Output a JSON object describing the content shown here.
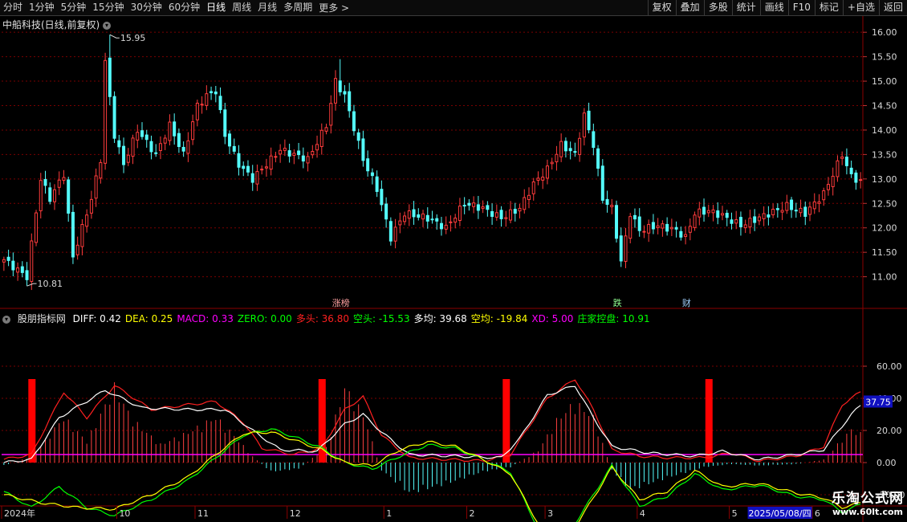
{
  "toolbar": {
    "timeframes": [
      "分时",
      "1分钟",
      "5分钟",
      "15分钟",
      "30分钟",
      "60分钟",
      "日线",
      "周线",
      "月线",
      "多周期"
    ],
    "active": "日线",
    "more": "更多 >",
    "tools": [
      "复权",
      "叠加",
      "多股",
      "统计",
      "画线",
      "F10",
      "标记",
      "+自选",
      "返回"
    ]
  },
  "price_panel": {
    "title": "中船科技(日线,前复权)"
  },
  "indicator_header": {
    "name": "股朋指标网",
    "items": [
      {
        "label": "DIFF",
        "value": "0.42",
        "color": "#ffffff"
      },
      {
        "label": "DEA",
        "value": "0.25",
        "color": "#ffff00"
      },
      {
        "label": "MACD",
        "value": "0.33",
        "color": "#ff00ff"
      },
      {
        "label": "ZERO",
        "value": "0.00",
        "color": "#00ff00"
      },
      {
        "label": "多头",
        "value": "36.80",
        "color": "#ff2020"
      },
      {
        "label": "空头",
        "value": "-15.53",
        "color": "#00ff00"
      },
      {
        "label": "多均",
        "value": "39.68",
        "color": "#ffffff"
      },
      {
        "label": "空均",
        "value": "-19.84",
        "color": "#ffff00"
      },
      {
        "label": "XD",
        "value": "5.00",
        "color": "#ff00ff"
      },
      {
        "label": "庄家控盘",
        "value": "10.91",
        "color": "#00ff00"
      }
    ]
  },
  "chart_data": [
    {
      "type": "candlestick",
      "title": "中船科技(日线,前复权)",
      "ylim": [
        10.55,
        16.2
      ],
      "yticks": [
        "16.00",
        "15.50",
        "15.00",
        "14.50",
        "14.00",
        "13.50",
        "13.00",
        "12.50",
        "12.00",
        "11.50",
        "11.00"
      ],
      "high_label": "15.95",
      "low_label": "10.81",
      "x_labels": [
        "2024年",
        "10",
        "11",
        "12",
        "1",
        "2",
        "3",
        "4",
        "5",
        "6"
      ],
      "cursor_date": "2025/05/08/四",
      "events": [
        "涨榜",
        "跌",
        "财"
      ],
      "anchors": [
        [
          0,
          11.35
        ],
        [
          5,
          11.0
        ],
        [
          8,
          13.0
        ],
        [
          10,
          12.6
        ],
        [
          13,
          13.1
        ],
        [
          15,
          11.4
        ],
        [
          19,
          12.6
        ],
        [
          21,
          13.4
        ],
        [
          22,
          15.4
        ],
        [
          24,
          13.9
        ],
        [
          26,
          13.3
        ],
        [
          29,
          14.0
        ],
        [
          33,
          13.5
        ],
        [
          36,
          14.1
        ],
        [
          39,
          13.5
        ],
        [
          42,
          14.5
        ],
        [
          44,
          14.7
        ],
        [
          46,
          14.8
        ],
        [
          48,
          13.9
        ],
        [
          51,
          13.3
        ],
        [
          54,
          13.0
        ],
        [
          57,
          13.3
        ],
        [
          60,
          13.6
        ],
        [
          63,
          13.5
        ],
        [
          66,
          13.4
        ],
        [
          70,
          14.1
        ],
        [
          72,
          15.0
        ],
        [
          74,
          14.7
        ],
        [
          78,
          13.4
        ],
        [
          81,
          12.8
        ],
        [
          84,
          11.8
        ],
        [
          87,
          12.3
        ],
        [
          92,
          12.2
        ],
        [
          96,
          12.0
        ],
        [
          100,
          12.5
        ],
        [
          104,
          12.4
        ],
        [
          108,
          12.2
        ],
        [
          112,
          12.4
        ],
        [
          115,
          12.9
        ],
        [
          118,
          13.2
        ],
        [
          121,
          13.7
        ],
        [
          124,
          13.5
        ],
        [
          126,
          14.3
        ],
        [
          128,
          13.7
        ],
        [
          130,
          12.6
        ],
        [
          132,
          12.4
        ],
        [
          134,
          11.3
        ],
        [
          136,
          12.3
        ],
        [
          138,
          11.95
        ],
        [
          142,
          12.05
        ],
        [
          146,
          11.95
        ],
        [
          148,
          11.8
        ],
        [
          150,
          12.3
        ],
        [
          153,
          12.35
        ],
        [
          156,
          12.25
        ],
        [
          160,
          12.05
        ],
        [
          165,
          12.25
        ],
        [
          170,
          12.45
        ],
        [
          174,
          12.3
        ],
        [
          178,
          12.7
        ],
        [
          180,
          13.1
        ],
        [
          182,
          13.5
        ],
        [
          184,
          13.05
        ],
        [
          186,
          12.95
        ]
      ],
      "spikes": [
        {
          "i": 23,
          "high": 15.95
        },
        {
          "i": 5,
          "low": 10.81
        },
        {
          "i": 73,
          "high": 15.45
        },
        {
          "i": 126,
          "high": 14.45
        },
        {
          "i": 134,
          "low": 11.2
        }
      ]
    },
    {
      "type": "indicator",
      "ylim": [
        -27,
        88
      ],
      "yticks": [
        "60.00",
        "40.00",
        "20.00",
        "0.00",
        "-20.00"
      ],
      "current_value": "37.75",
      "signal_indices": [
        6,
        69,
        109,
        153
      ],
      "xd_level": 5,
      "series": [
        {
          "name": "多头",
          "color": "#ff2020",
          "anchors": [
            [
              0,
              2
            ],
            [
              6,
              5
            ],
            [
              13,
              44
            ],
            [
              18,
              28
            ],
            [
              24,
              48
            ],
            [
              32,
              33
            ],
            [
              40,
              36
            ],
            [
              46,
              38
            ],
            [
              52,
              25
            ],
            [
              56,
              9
            ],
            [
              63,
              5
            ],
            [
              69,
              9
            ],
            [
              74,
              33
            ],
            [
              78,
              41
            ],
            [
              82,
              17
            ],
            [
              88,
              3
            ],
            [
              96,
              2
            ],
            [
              104,
              1
            ],
            [
              110,
              5
            ],
            [
              118,
              40
            ],
            [
              124,
              52
            ],
            [
              128,
              33
            ],
            [
              132,
              8
            ],
            [
              138,
              4
            ],
            [
              144,
              3
            ],
            [
              152,
              3
            ],
            [
              158,
              6
            ],
            [
              164,
              1
            ],
            [
              172,
              4
            ],
            [
              178,
              10
            ],
            [
              182,
              36
            ],
            [
              186,
              44
            ],
            [
              190,
              38
            ]
          ]
        },
        {
          "name": "多均",
          "color": "#ffffff",
          "anchors": [
            [
              0,
              0
            ],
            [
              6,
              2
            ],
            [
              12,
              28
            ],
            [
              22,
              45
            ],
            [
              30,
              34
            ],
            [
              40,
              33
            ],
            [
              48,
              33
            ],
            [
              54,
              20
            ],
            [
              60,
              8
            ],
            [
              68,
              7
            ],
            [
              74,
              24
            ],
            [
              78,
              30
            ],
            [
              82,
              19
            ],
            [
              88,
              5
            ],
            [
              98,
              4
            ],
            [
              108,
              3
            ],
            [
              112,
              15
            ],
            [
              118,
              42
            ],
            [
              124,
              48
            ],
            [
              128,
              28
            ],
            [
              132,
              10
            ],
            [
              140,
              6
            ],
            [
              150,
              4
            ],
            [
              156,
              7
            ],
            [
              164,
              2
            ],
            [
              172,
              5
            ],
            [
              178,
              8
            ],
            [
              184,
              30
            ],
            [
              188,
              41
            ],
            [
              190,
              39
            ]
          ]
        },
        {
          "name": "空头",
          "color": "#00ff00",
          "anchors": [
            [
              0,
              -18
            ],
            [
              6,
              -28
            ],
            [
              12,
              -15
            ],
            [
              18,
              -28
            ],
            [
              24,
              -33
            ],
            [
              32,
              -23
            ],
            [
              40,
              -11
            ],
            [
              46,
              3
            ],
            [
              52,
              17
            ],
            [
              58,
              21
            ],
            [
              64,
              15
            ],
            [
              69,
              9
            ],
            [
              74,
              0
            ],
            [
              80,
              -4
            ],
            [
              86,
              4
            ],
            [
              92,
              11
            ],
            [
              98,
              9
            ],
            [
              104,
              2
            ],
            [
              110,
              -6
            ],
            [
              116,
              -41
            ],
            [
              120,
              -50
            ],
            [
              124,
              -38
            ],
            [
              128,
              -20
            ],
            [
              132,
              -2
            ],
            [
              138,
              -27
            ],
            [
              144,
              -21
            ],
            [
              150,
              -7
            ],
            [
              156,
              -17
            ],
            [
              164,
              -14
            ],
            [
              172,
              -21
            ],
            [
              178,
              -23
            ],
            [
              182,
              -31
            ],
            [
              186,
              -26
            ],
            [
              190,
              -16
            ]
          ]
        },
        {
          "name": "空均",
          "color": "#ffff00",
          "anchors": [
            [
              0,
              -20
            ],
            [
              8,
              -25
            ],
            [
              16,
              -28
            ],
            [
              24,
              -29
            ],
            [
              32,
              -20
            ],
            [
              40,
              -9
            ],
            [
              46,
              5
            ],
            [
              52,
              18
            ],
            [
              58,
              19
            ],
            [
              64,
              13
            ],
            [
              69,
              8
            ],
            [
              74,
              0
            ],
            [
              80,
              -2
            ],
            [
              86,
              8
            ],
            [
              92,
              13
            ],
            [
              98,
              10
            ],
            [
              104,
              2
            ],
            [
              110,
              -7
            ],
            [
              116,
              -38
            ],
            [
              120,
              -44
            ],
            [
              124,
              -40
            ],
            [
              128,
              -22
            ],
            [
              132,
              -3
            ],
            [
              138,
              -23
            ],
            [
              144,
              -18
            ],
            [
              150,
              -5
            ],
            [
              156,
              -15
            ],
            [
              164,
              -13
            ],
            [
              172,
              -19
            ],
            [
              178,
              -22
            ],
            [
              182,
              -28
            ],
            [
              186,
              -25
            ],
            [
              190,
              -18
            ]
          ]
        },
        {
          "name": "MACD",
          "color": "#ff4040",
          "anchors": [
            [
              0,
              -2
            ],
            [
              6,
              4
            ],
            [
              13,
              30
            ],
            [
              18,
              14
            ],
            [
              24,
              50
            ],
            [
              28,
              28
            ],
            [
              34,
              12
            ],
            [
              40,
              20
            ],
            [
              46,
              30
            ],
            [
              50,
              18
            ],
            [
              54,
              4
            ],
            [
              58,
              -6
            ],
            [
              64,
              -4
            ],
            [
              70,
              10
            ],
            [
              74,
              50
            ],
            [
              78,
              32
            ],
            [
              82,
              -5
            ],
            [
              88,
              -20
            ],
            [
              96,
              -14
            ],
            [
              104,
              -6
            ],
            [
              110,
              -3
            ],
            [
              116,
              8
            ],
            [
              120,
              28
            ],
            [
              124,
              40
            ],
            [
              128,
              30
            ],
            [
              132,
              -5
            ],
            [
              136,
              -18
            ],
            [
              144,
              -10
            ],
            [
              152,
              -3
            ],
            [
              158,
              -1
            ],
            [
              164,
              -2
            ],
            [
              172,
              -1
            ],
            [
              178,
              2
            ],
            [
              184,
              22
            ],
            [
              188,
              16
            ],
            [
              190,
              10
            ]
          ]
        }
      ]
    }
  ]
}
